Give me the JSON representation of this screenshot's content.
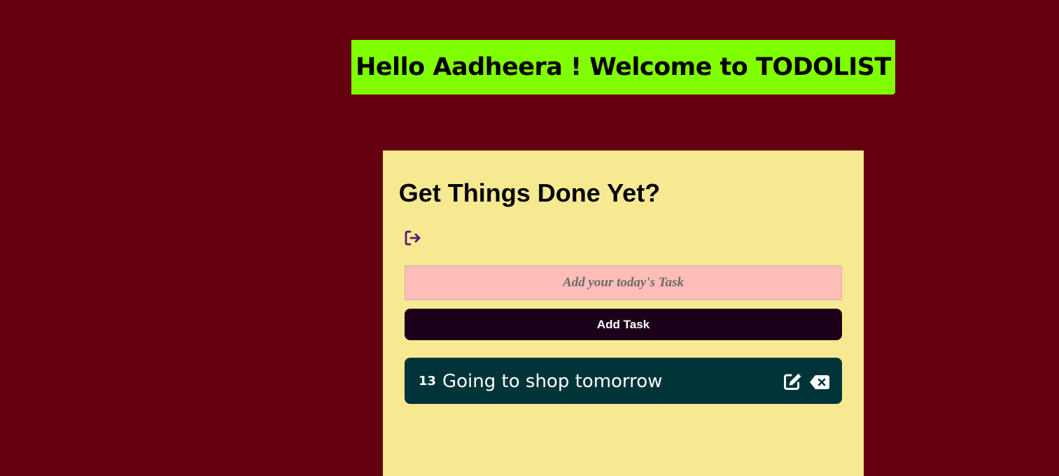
{
  "colors": {
    "background": "#650010",
    "banner": "#80ff00",
    "card": "#f6e992",
    "input_bg": "#ffbdb8",
    "button_bg": "#1c0019",
    "task_bg": "#003439",
    "logout_icon": "#5b1676"
  },
  "banner": {
    "text": "Hello Aadheera ! Welcome to TODOLIST"
  },
  "card": {
    "title": "Get Things Done Yet?",
    "logout_icon": "right-from-bracket-icon"
  },
  "task_input": {
    "placeholder": "Add your today's Task",
    "value": ""
  },
  "add_button": {
    "label": "Add Task"
  },
  "tasks": [
    {
      "number": "13",
      "text": "Going to shop tomorrow",
      "edit_icon": "pen-to-square-icon",
      "delete_icon": "delete-left-icon"
    }
  ]
}
